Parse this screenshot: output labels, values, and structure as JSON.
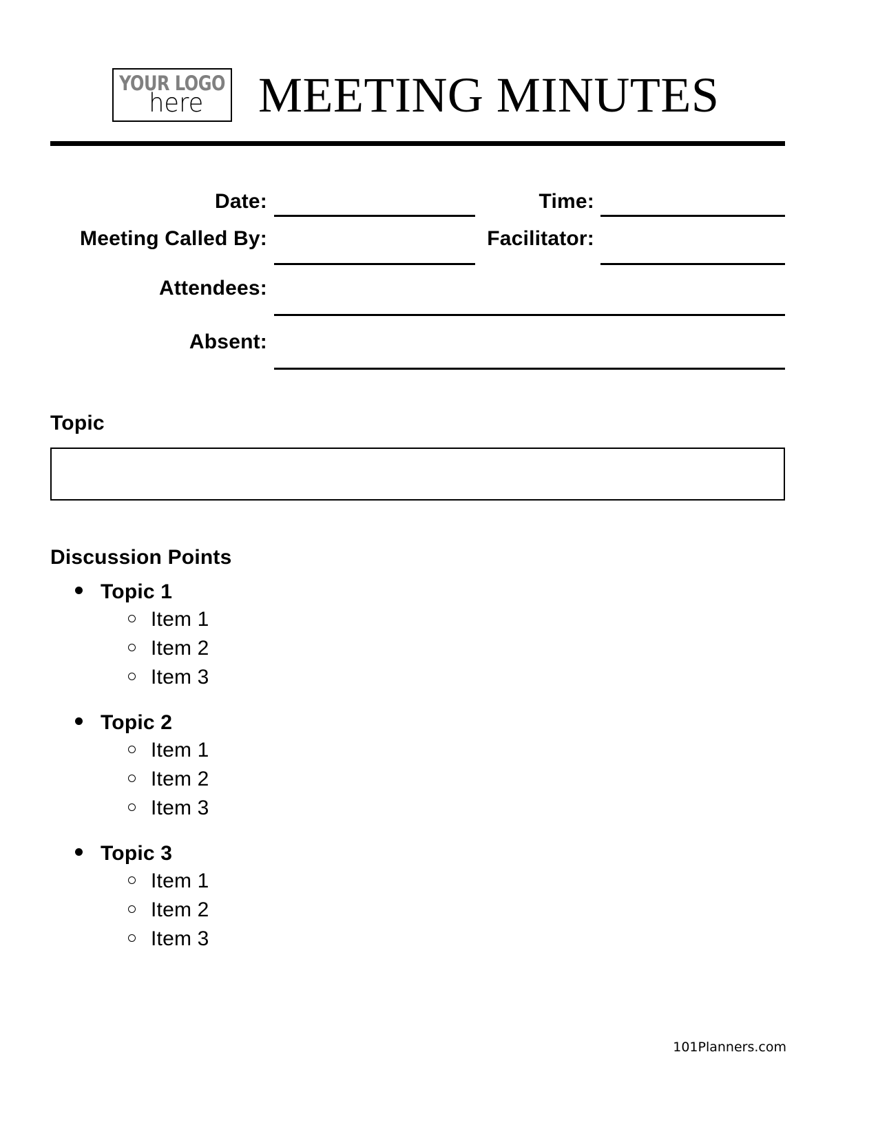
{
  "document": {
    "title": "MEETING MINUTES"
  },
  "logo": {
    "line1": "YOUR LOGO",
    "line2": "here",
    "line1_color": "#808080",
    "line2_color": "#000000"
  },
  "fields": [
    {
      "key": "date",
      "label": "Date:",
      "value": ""
    },
    {
      "key": "time",
      "label": "Time:",
      "value": ""
    },
    {
      "key": "called_by",
      "label": "Meeting Called By:",
      "value": ""
    },
    {
      "key": "facilitator",
      "label": "Facilitator:",
      "value": ""
    },
    {
      "key": "attendees",
      "label": "Attendees:",
      "value": ""
    },
    {
      "key": "absent",
      "label": "Absent:",
      "value": ""
    }
  ],
  "topic_section": {
    "heading": "Topic",
    "value": ""
  },
  "discussion_section": {
    "heading": "Discussion Points",
    "topics": [
      {
        "label": "Topic 1",
        "items": [
          "Item 1",
          "Item 2",
          "Item 3"
        ]
      },
      {
        "label": "Topic 2",
        "items": [
          "Item 1",
          "Item 2",
          "Item 3"
        ]
      },
      {
        "label": "Topic 3",
        "items": [
          "Item 1",
          "Item 2",
          "Item 3"
        ]
      }
    ]
  },
  "footer": {
    "credit": "101Planners.com"
  }
}
